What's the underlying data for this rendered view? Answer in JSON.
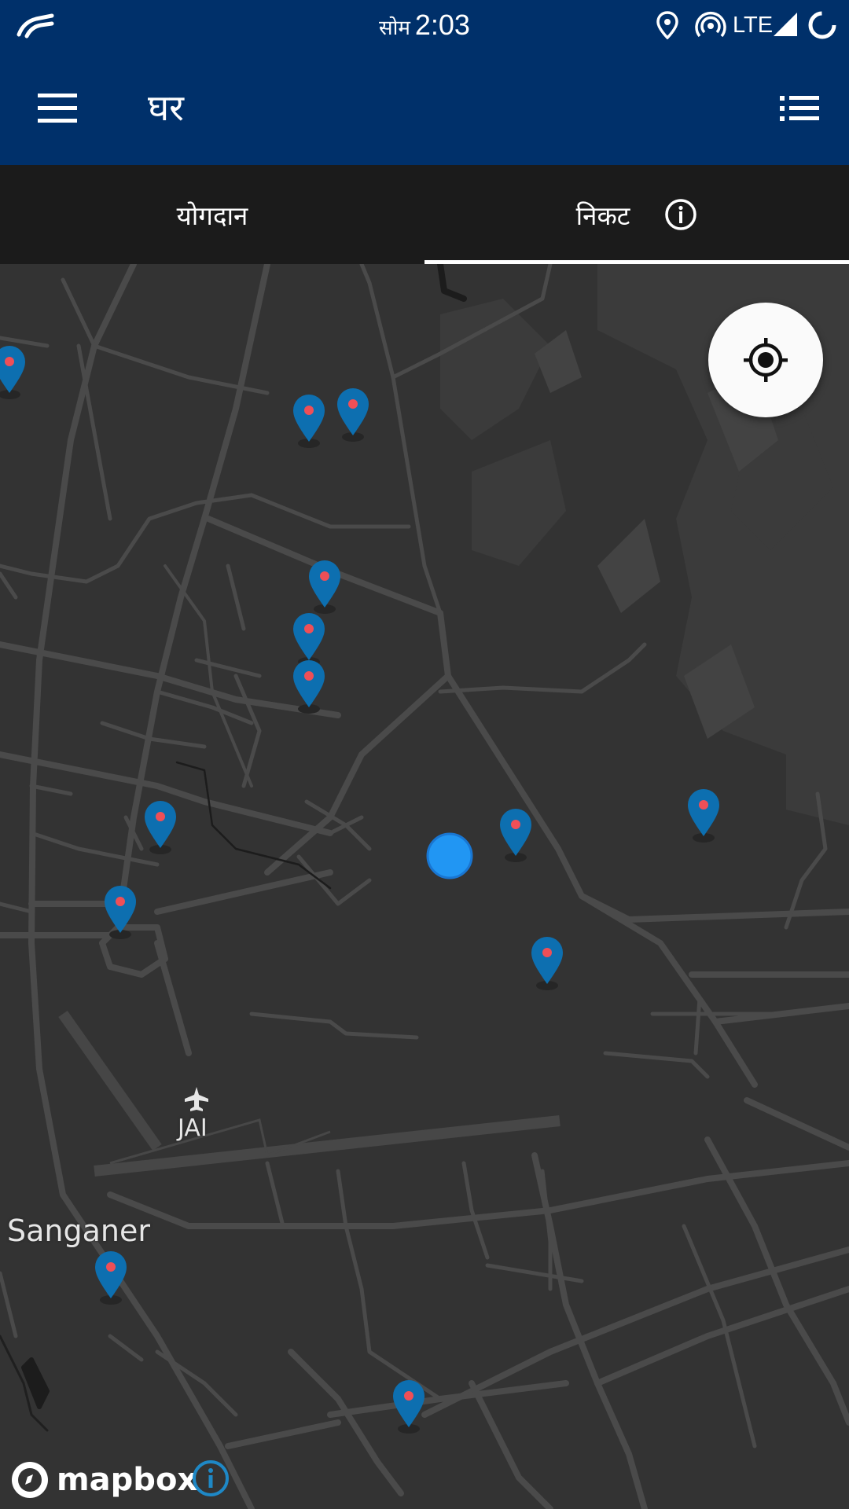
{
  "status_bar": {
    "day": "सोम",
    "time": "2:03",
    "network": "LTE",
    "icons": [
      "app-logo-icon",
      "location-icon",
      "hotspot-icon",
      "signal-icon",
      "sync-icon"
    ]
  },
  "app_bar": {
    "title": "घर",
    "menu_icon": "hamburger-icon",
    "list_icon": "list-view-icon",
    "background": "#00306a"
  },
  "tabs": [
    {
      "label": "योगदान",
      "selected": false
    },
    {
      "label": "निकट",
      "selected": true,
      "icon": "info-icon"
    }
  ],
  "map": {
    "labels": {
      "airport_code": "JAI",
      "place": "Sanganer"
    },
    "attribution": {
      "logo_text": "mapbox",
      "info_icon": "info-icon"
    },
    "locate_button_icon": "my-location-icon",
    "marker_color": "#0d6fb0",
    "marker_dot_color": "#ef4f57",
    "user_location_color": "#2196f3"
  }
}
